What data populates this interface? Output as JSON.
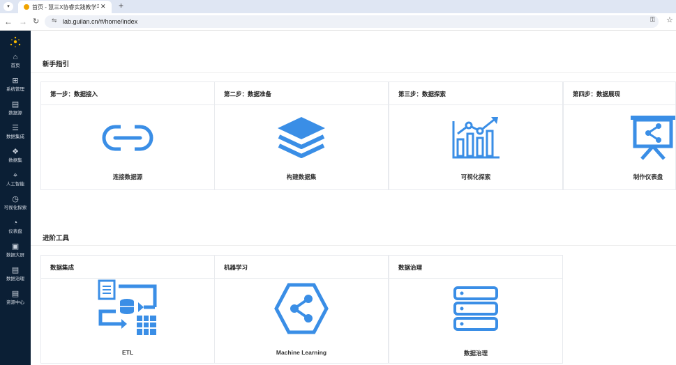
{
  "browser": {
    "tab_title": "首页 - 慧三X协睿实践教学平台",
    "url": "lab.guilan.cn/#/home/index"
  },
  "sidebar": {
    "items": [
      {
        "label": "首页",
        "icon": "home-icon"
      },
      {
        "label": "系统管理",
        "icon": "grid-icon"
      },
      {
        "label": "数据源",
        "icon": "database-icon"
      },
      {
        "label": "数据集成",
        "icon": "stack-icon"
      },
      {
        "label": "数据集",
        "icon": "cube-icon"
      },
      {
        "label": "人工智能",
        "icon": "ai-icon"
      },
      {
        "label": "可视化探索",
        "icon": "pie-icon"
      },
      {
        "label": "仪表盘",
        "icon": "gauge-icon"
      },
      {
        "label": "数据大屏",
        "icon": "screen-icon"
      },
      {
        "label": "数据治理",
        "icon": "list-icon"
      },
      {
        "label": "资源中心",
        "icon": "folder-icon"
      }
    ]
  },
  "guide": {
    "title": "新手指引",
    "cards": [
      {
        "header": "第一步：数据接入",
        "label": "连接数据源"
      },
      {
        "header": "第二步：数据准备",
        "label": "构建数据集"
      },
      {
        "header": "第三步：数据探索",
        "label": "可视化探索"
      },
      {
        "header": "第四步：数据展现",
        "label": "制作仪表盘"
      }
    ]
  },
  "tools": {
    "title": "进阶工具",
    "cards": [
      {
        "header": "数据集成",
        "label": "ETL"
      },
      {
        "header": "机器学习",
        "label": "Machine Learning"
      },
      {
        "header": "数据治理",
        "label": "数据治理"
      }
    ]
  },
  "colors": {
    "accent": "#3a8ee6",
    "sidebar_bg": "#0b1f35"
  }
}
